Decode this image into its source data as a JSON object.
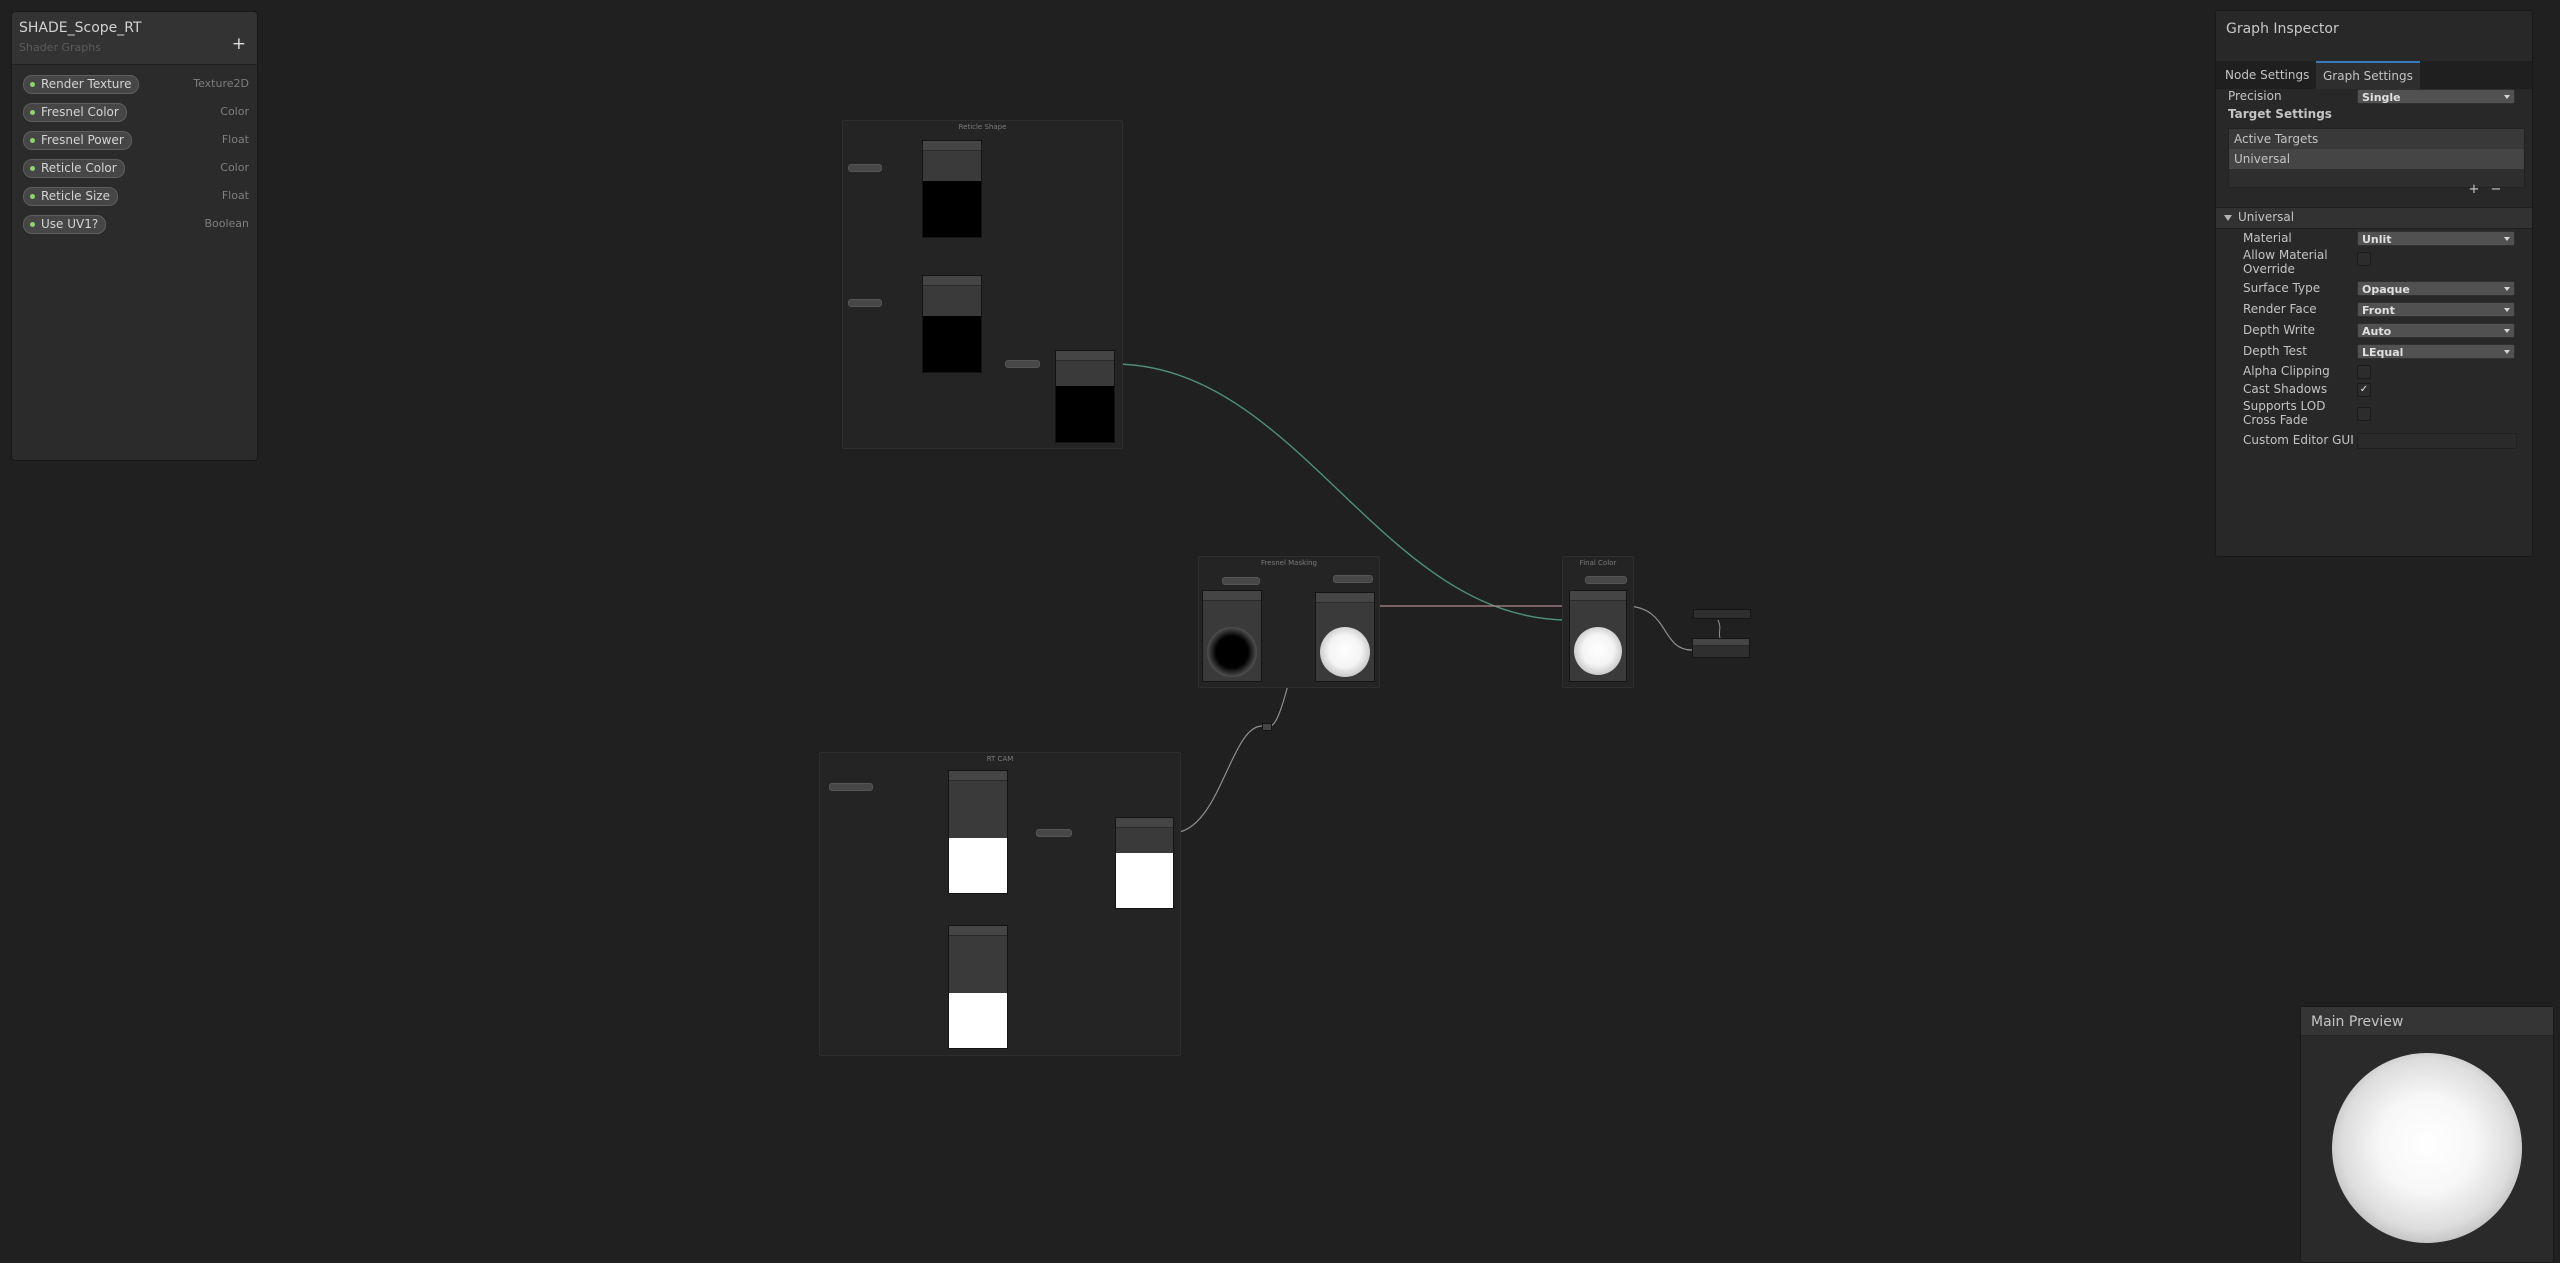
{
  "blackboard": {
    "title": "SHADE_Scope_RT",
    "subtitle": "Shader Graphs",
    "add_label": "+",
    "properties": [
      {
        "name": "Render Texture",
        "type": "Texture2D"
      },
      {
        "name": "Fresnel Color",
        "type": "Color"
      },
      {
        "name": "Fresnel Power",
        "type": "Float"
      },
      {
        "name": "Reticle Color",
        "type": "Color"
      },
      {
        "name": "Reticle Size",
        "type": "Float"
      },
      {
        "name": "Use UV1?",
        "type": "Boolean"
      }
    ]
  },
  "graph": {
    "groups": {
      "reticle_shape": "Reticle Shape",
      "fresnel_masking": "Fresnel Masking",
      "final_color": "Final Color",
      "rt_cam": "RT CAM"
    }
  },
  "inspector": {
    "title": "Graph Inspector",
    "tabs": [
      {
        "label": "Node Settings",
        "active": false
      },
      {
        "label": "Graph Settings",
        "active": true
      }
    ],
    "precision_label": "Precision",
    "precision_value": "Single",
    "target_settings_label": "Target Settings",
    "active_targets_label": "Active Targets",
    "active_target_item": "Universal",
    "add_label": "+",
    "remove_label": "−",
    "section_label": "Universal",
    "fields": {
      "material": {
        "label": "Material",
        "value": "Unlit"
      },
      "allow_material_override": {
        "label": "Allow Material Override",
        "checked": false
      },
      "surface_type": {
        "label": "Surface Type",
        "value": "Opaque"
      },
      "render_face": {
        "label": "Render Face",
        "value": "Front"
      },
      "depth_write": {
        "label": "Depth Write",
        "value": "Auto"
      },
      "depth_test": {
        "label": "Depth Test",
        "value": "LEqual"
      },
      "alpha_clipping": {
        "label": "Alpha Clipping",
        "checked": false
      },
      "cast_shadows": {
        "label": "Cast Shadows",
        "checked": true,
        "mark": "✓"
      },
      "supports_lod_cross_fade": {
        "label": "Supports LOD Cross Fade",
        "checked": false
      },
      "custom_editor_gui": {
        "label": "Custom Editor GUI",
        "value": ""
      }
    }
  },
  "main_preview": {
    "title": "Main Preview"
  },
  "colors": {
    "canvas": "#202020",
    "panel": "#2b2b2b",
    "accent_tab": "#3a79bb",
    "property_dot": "#8fd56e",
    "wire_vector": "#4e8f7e",
    "wire_texture": "#b06578",
    "wire_float": "#8f8f8f"
  }
}
